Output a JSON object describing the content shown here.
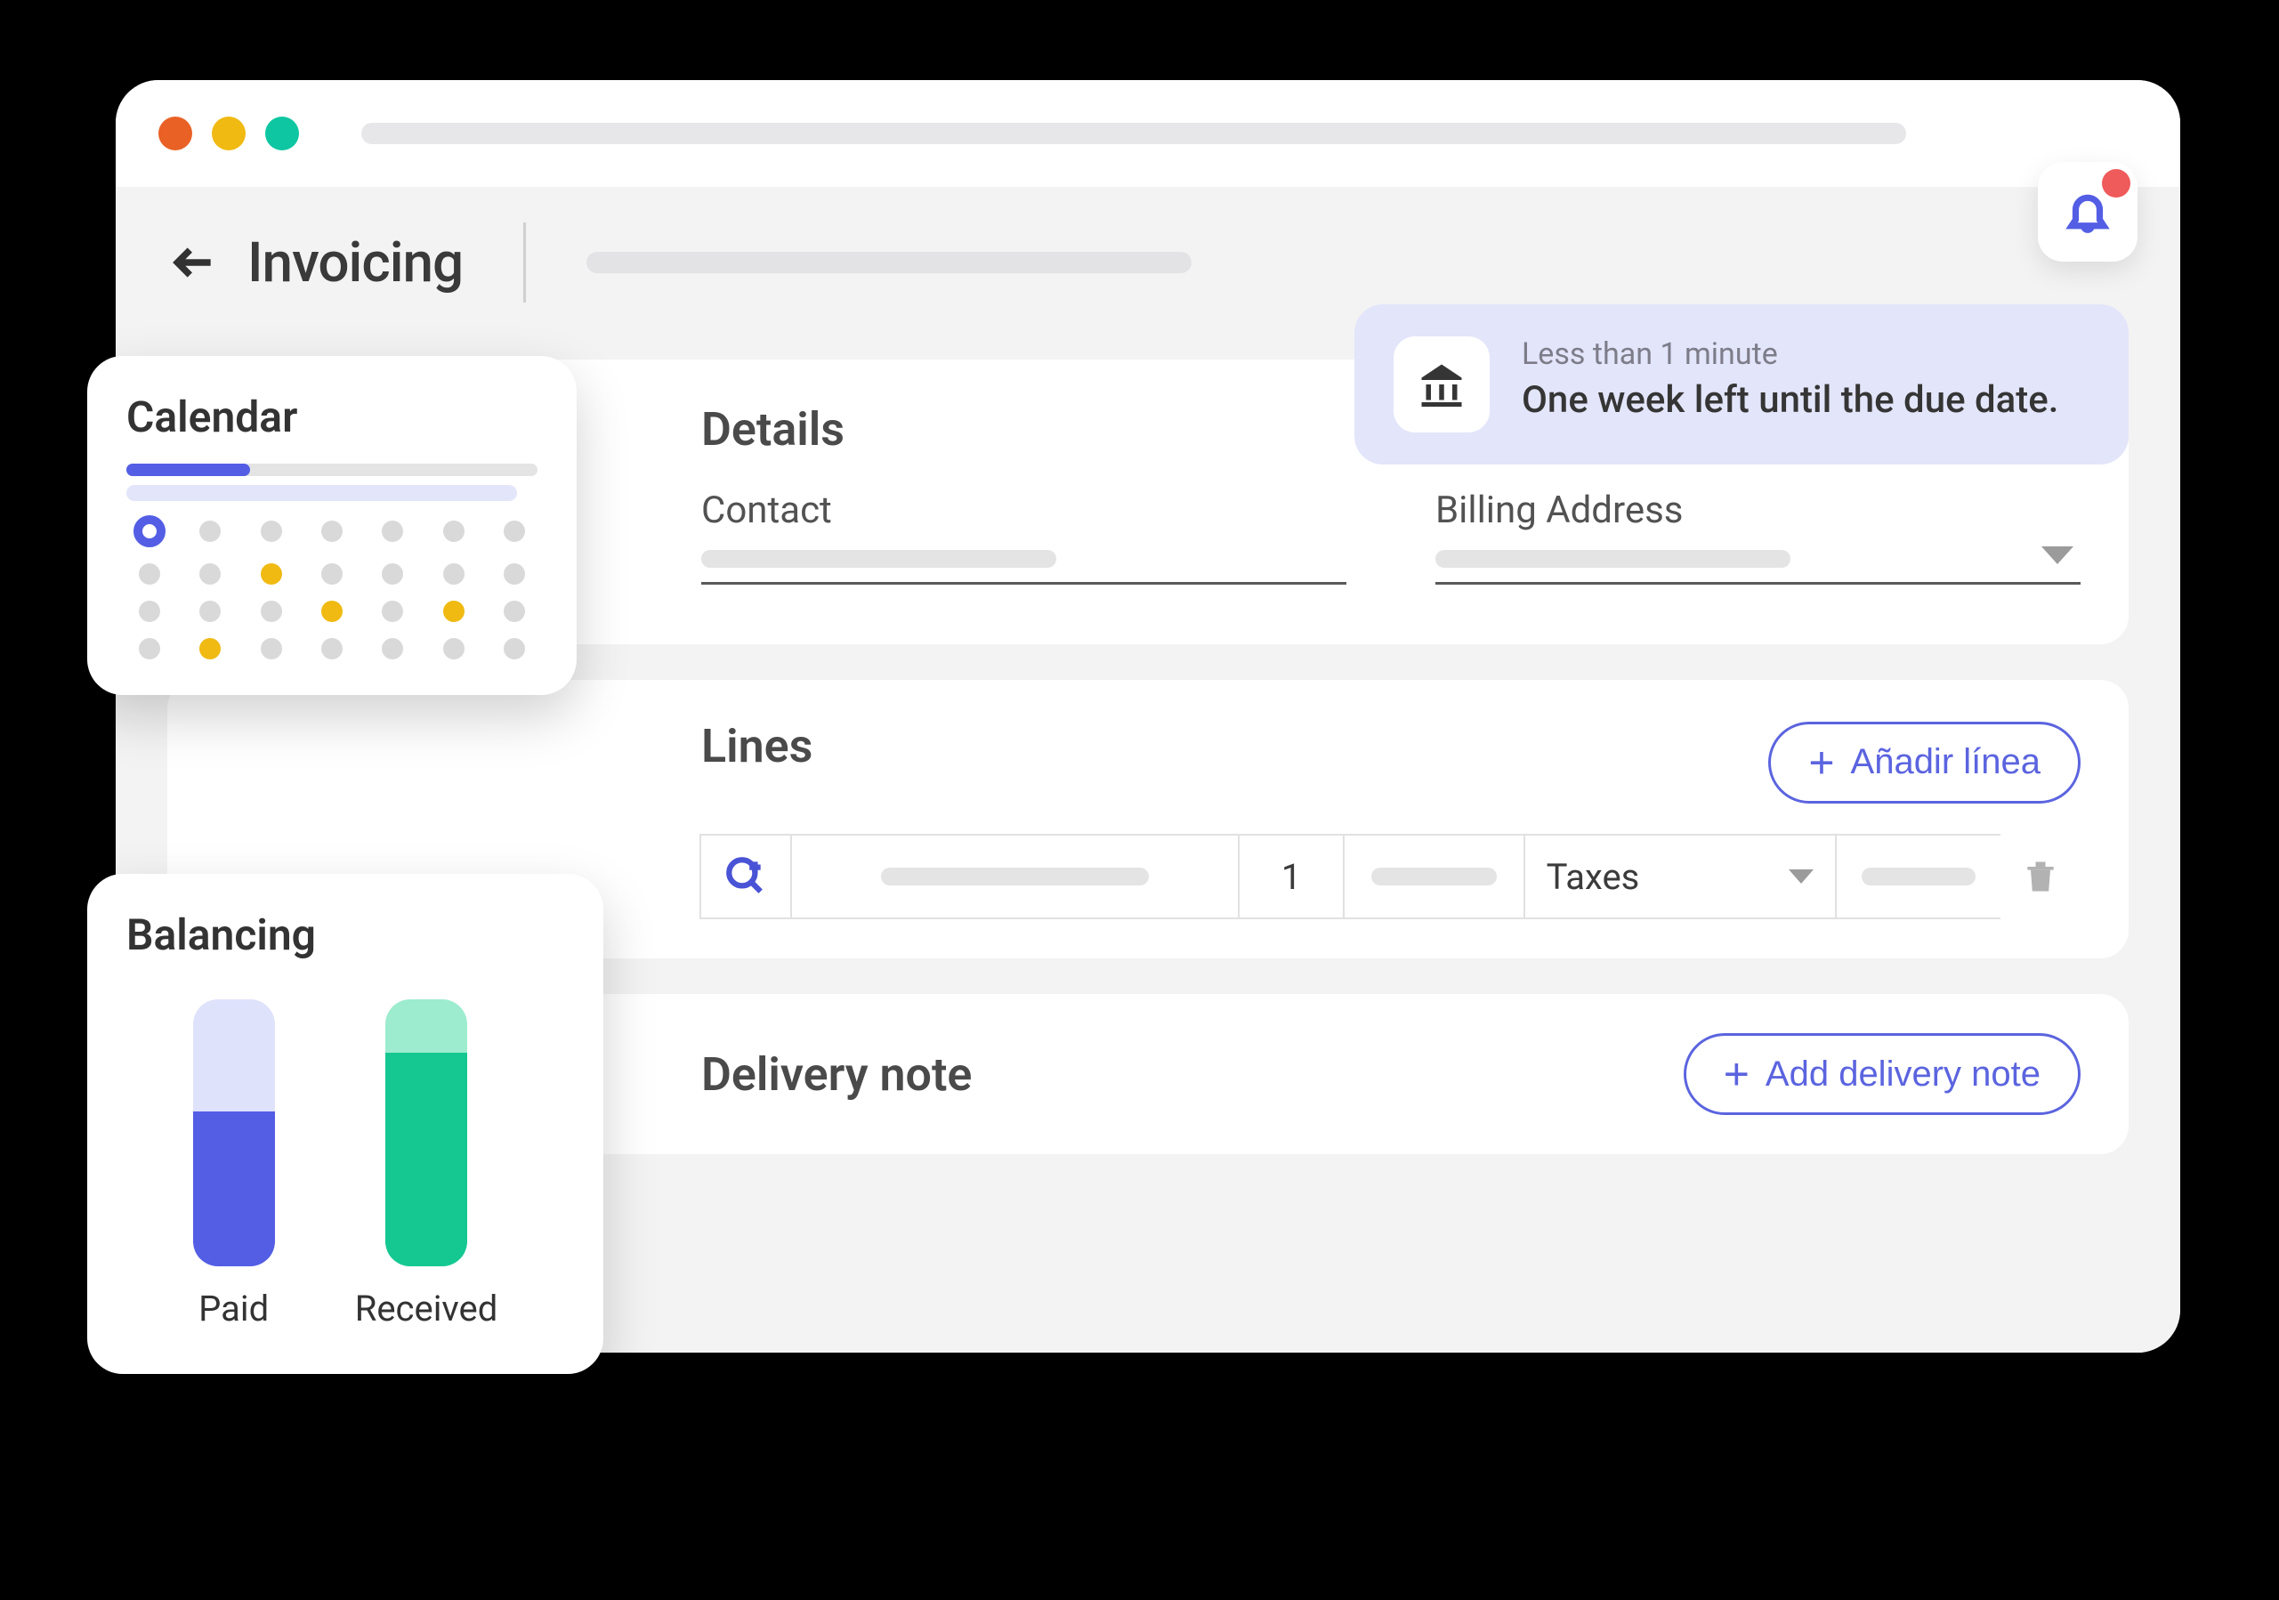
{
  "page": {
    "title": "Invoicing"
  },
  "notification": {
    "time": "Less than 1 minute",
    "message": "One week left until the due date."
  },
  "details": {
    "heading": "Details",
    "contact_label": "Contact",
    "billing_label": "Billing Address"
  },
  "lines": {
    "heading": "Lines",
    "add_label": "Añadir línea",
    "row": {
      "qty": "1",
      "tax_label": "Taxes"
    }
  },
  "delivery": {
    "heading": "Delivery note",
    "add_label": "Add delivery note"
  },
  "calendar": {
    "title": "Calendar"
  },
  "balancing": {
    "title": "Balancing",
    "paid_label": "Paid",
    "received_label": "Received"
  },
  "chart_data": {
    "type": "bar",
    "title": "Balancing",
    "categories": [
      "Paid",
      "Received"
    ],
    "values": [
      58,
      80
    ],
    "ylim": [
      0,
      100
    ],
    "series_colors": [
      "#535ee5",
      "#15c892"
    ]
  }
}
